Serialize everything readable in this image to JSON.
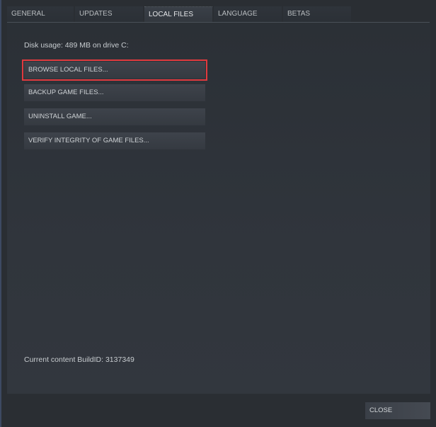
{
  "tabs": [
    {
      "label": "GENERAL",
      "active": false
    },
    {
      "label": "UPDATES",
      "active": false
    },
    {
      "label": "LOCAL FILES",
      "active": true
    },
    {
      "label": "LANGUAGE",
      "active": false
    },
    {
      "label": "BETAS",
      "active": false
    }
  ],
  "local_files": {
    "disk_usage": "Disk usage: 489 MB on drive C:",
    "buttons": [
      {
        "label": "BROWSE LOCAL FILES...",
        "highlighted": true
      },
      {
        "label": "BACKUP GAME FILES...",
        "highlighted": false
      },
      {
        "label": "UNINSTALL GAME...",
        "highlighted": false
      },
      {
        "label": "VERIFY INTEGRITY OF GAME FILES...",
        "highlighted": false
      }
    ],
    "build_id": "Current content BuildID: 3137349"
  },
  "footer": {
    "close_label": "CLOSE"
  },
  "colors": {
    "highlight_outline": "#e03a3e",
    "background": "#2a2e33",
    "panel": "#30353c"
  }
}
